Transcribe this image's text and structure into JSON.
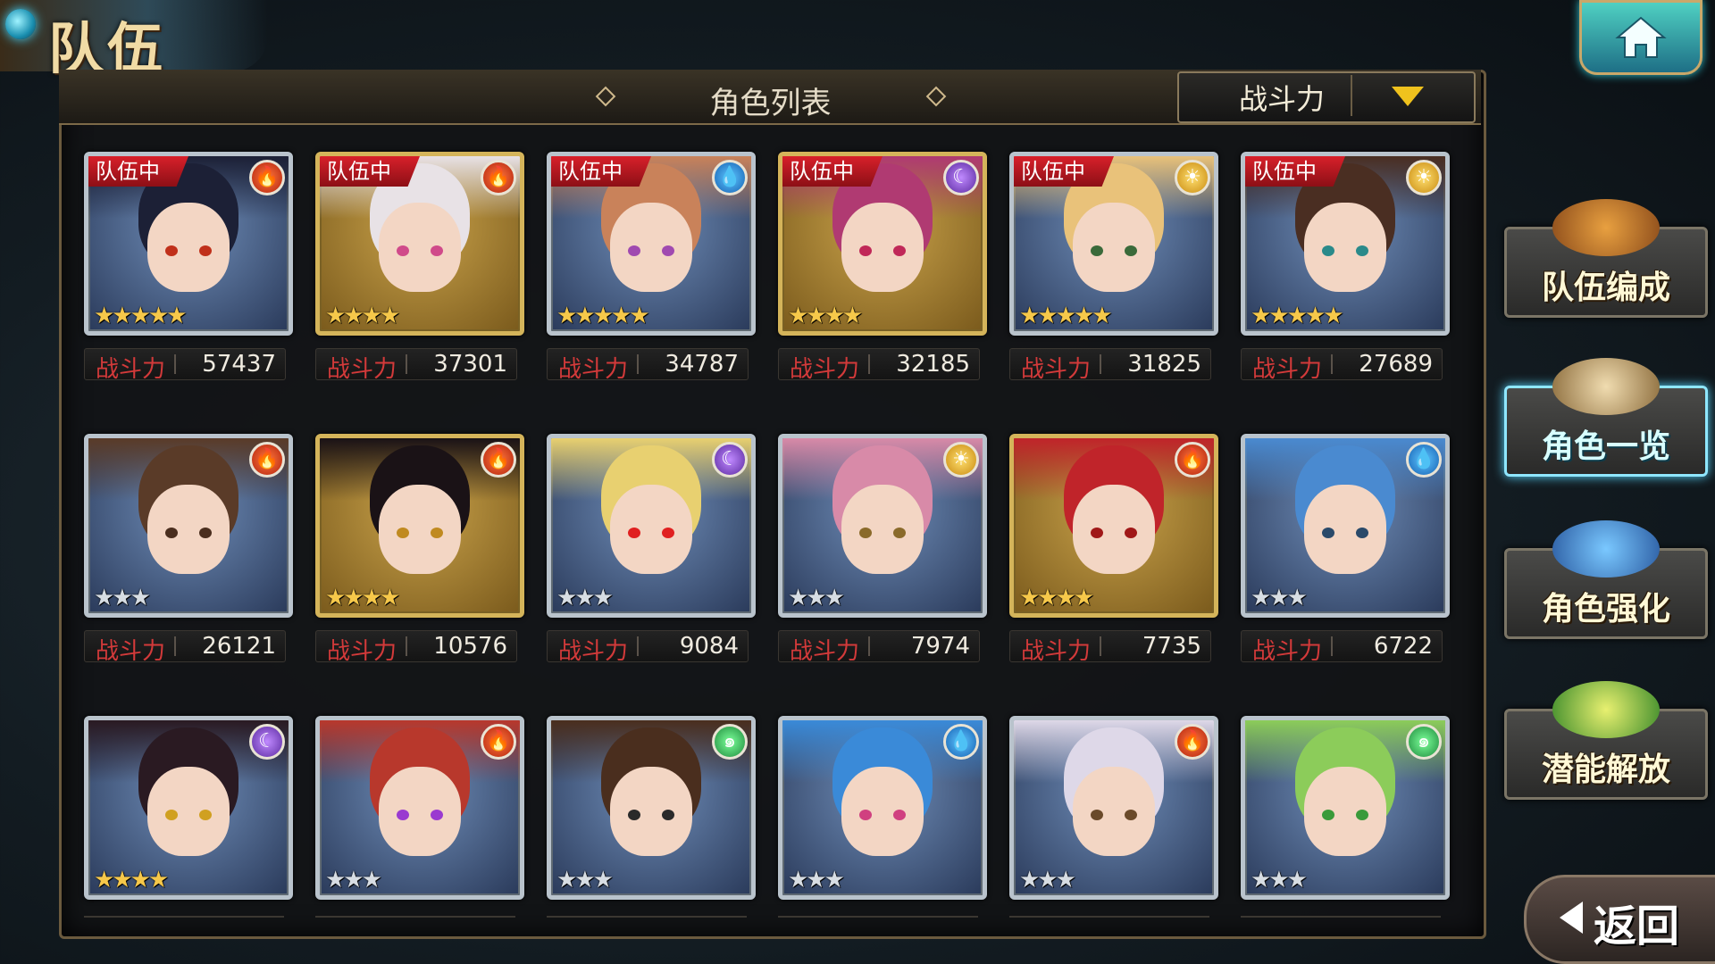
{
  "header": {
    "page_title": "队伍",
    "panel_title": "角色列表",
    "sort_label": "战斗力"
  },
  "power_label": "战斗力",
  "team_tag": "队伍中",
  "characters": [
    {
      "power": "57437",
      "element": "fire",
      "element_icon": "🔥",
      "stars": "★★★★★",
      "rarity": "silver-frame",
      "in_team": true
    },
    {
      "power": "37301",
      "element": "fire",
      "element_icon": "🔥",
      "stars": "★★★★",
      "rarity": "gold-frame",
      "in_team": true
    },
    {
      "power": "34787",
      "element": "water",
      "element_icon": "💧",
      "stars": "★★★★★",
      "rarity": "silver-frame",
      "in_team": true
    },
    {
      "power": "32185",
      "element": "moon",
      "element_icon": "☾",
      "stars": "★★★★",
      "rarity": "gold-frame",
      "in_team": true
    },
    {
      "power": "31825",
      "element": "sun",
      "element_icon": "☀",
      "stars": "★★★★★",
      "rarity": "silver-frame",
      "in_team": true
    },
    {
      "power": "27689",
      "element": "sun",
      "element_icon": "☀",
      "stars": "★★★★★",
      "rarity": "silver-frame",
      "in_team": true
    },
    {
      "power": "26121",
      "element": "fire",
      "element_icon": "🔥",
      "stars": "★★★",
      "rarity": "silver-frame",
      "in_team": false
    },
    {
      "power": "10576",
      "element": "fire",
      "element_icon": "🔥",
      "stars": "★★★★",
      "rarity": "gold-frame",
      "in_team": false
    },
    {
      "power": "9084",
      "element": "moon",
      "element_icon": "☾",
      "stars": "★★★",
      "rarity": "silver-frame",
      "in_team": false
    },
    {
      "power": "7974",
      "element": "sun",
      "element_icon": "☀",
      "stars": "★★★",
      "rarity": "silver-frame",
      "in_team": false
    },
    {
      "power": "7735",
      "element": "fire",
      "element_icon": "🔥",
      "stars": "★★★★",
      "rarity": "gold-frame",
      "in_team": false
    },
    {
      "power": "6722",
      "element": "water",
      "element_icon": "💧",
      "stars": "★★★",
      "rarity": "silver-frame",
      "in_team": false
    },
    {
      "element": "moon",
      "element_icon": "☾",
      "stars": "★★★★",
      "rarity": "silver-frame",
      "in_team": false
    },
    {
      "element": "fire",
      "element_icon": "🔥",
      "stars": "★★★",
      "rarity": "silver-frame",
      "in_team": false
    },
    {
      "element": "wind",
      "element_icon": "๑",
      "stars": "★★★",
      "rarity": "silver-frame",
      "in_team": false
    },
    {
      "element": "water",
      "element_icon": "💧",
      "stars": "★★★",
      "rarity": "silver-frame",
      "in_team": false
    },
    {
      "element": "fire",
      "element_icon": "🔥",
      "stars": "★★★",
      "rarity": "silver-frame",
      "in_team": false
    },
    {
      "element": "wind",
      "element_icon": "๑",
      "stars": "★★★",
      "rarity": "silver-frame",
      "in_team": false
    }
  ],
  "side_menu": [
    {
      "label": "队伍编成",
      "icon": "party-portraits-icon",
      "active": false
    },
    {
      "label": "角色一览",
      "icon": "book-icon",
      "active": true
    },
    {
      "label": "角色强化",
      "icon": "enhance-crystal-icon",
      "active": false
    },
    {
      "label": "潜能解放",
      "icon": "potential-orb-icon",
      "active": false
    }
  ],
  "back_label": "返回",
  "colors": {
    "accent_gold": "#d4b45a",
    "team_tag_red": "#d8202a",
    "power_label_red": "#d33a3a",
    "active_menu_glow": "#59d8ff",
    "sort_arrow_yellow": "#f0c21d"
  }
}
